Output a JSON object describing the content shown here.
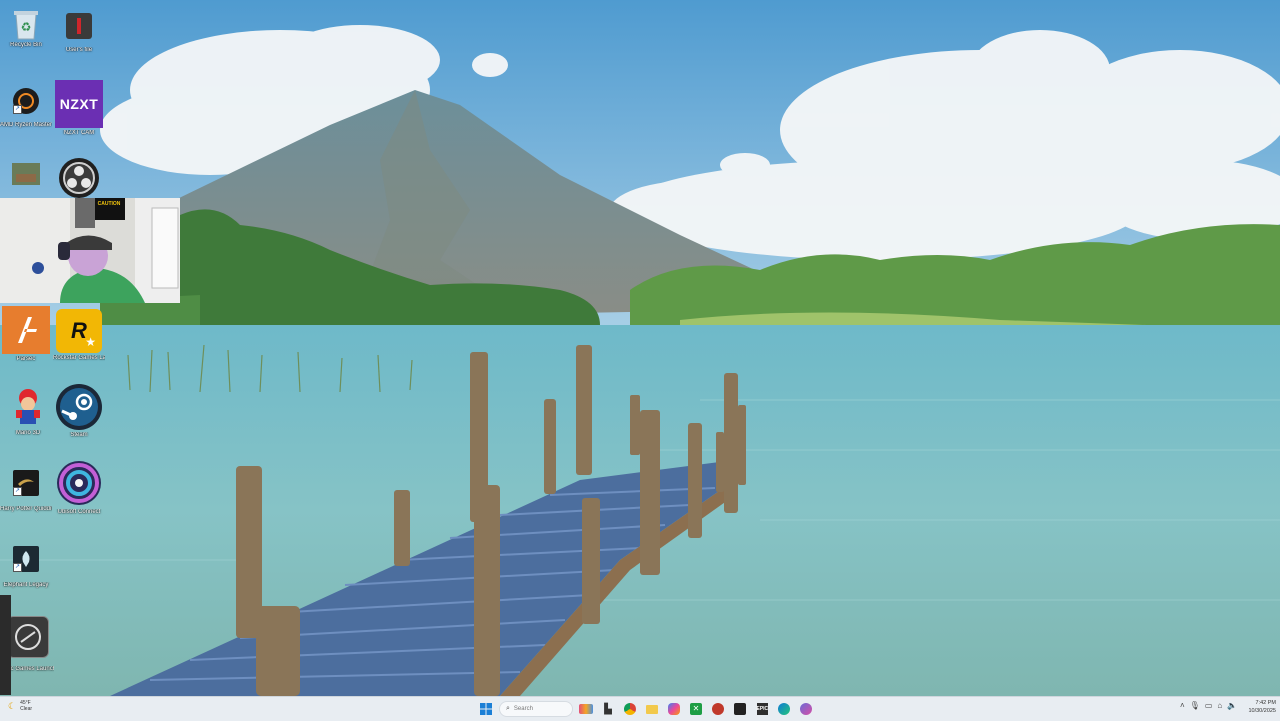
{
  "desktop": {
    "icons": [
      {
        "id": "recycle-bin",
        "label": "Recycle Bin"
      },
      {
        "id": "app-red",
        "label": "User's file"
      },
      {
        "id": "amd-ryzen-master",
        "label": "AMD Ryzen Master"
      },
      {
        "id": "nzxt-cam",
        "label": "NZXT CAM",
        "badge": "NZXT"
      },
      {
        "id": "photo-shortcut",
        "label": ""
      },
      {
        "id": "obs-studio",
        "label": ""
      },
      {
        "id": "parsec",
        "label": "Parsec"
      },
      {
        "id": "rockstar-launcher",
        "label": "Rockstar Games Launcher",
        "badge": "R"
      },
      {
        "id": "mario-game",
        "label": "Mario 3D"
      },
      {
        "id": "steam",
        "label": "Steam"
      },
      {
        "id": "harry-potter",
        "label": "Harry Potter Quidditch..."
      },
      {
        "id": "ubisoft-connect",
        "label": "Ubisoft Connect"
      },
      {
        "id": "elephant-app",
        "label": "Elephant Legacy"
      },
      {
        "id": "epic-launcher",
        "label": "Epic Games Launcher"
      }
    ]
  },
  "webcam": {
    "sign_text": "CAUTION"
  },
  "taskbar": {
    "weather": {
      "temp": "45°F",
      "condition": "Clear"
    },
    "search_placeholder": "Search",
    "apps": [
      "widgets",
      "task-view",
      "chrome",
      "file-explorer",
      "copilot",
      "xbox",
      "antivirus",
      "game-app",
      "epic-games",
      "edge",
      "teams"
    ],
    "clock": {
      "time": "7:42 PM",
      "date": "10/30/2025"
    }
  },
  "colors": {
    "sky": "#4f9bd0",
    "water": "#7cc0c8",
    "taskbar_bg": "#e8edf2",
    "nzxt_purple": "#6b2fb3",
    "rockstar_yellow": "#f2b705"
  }
}
